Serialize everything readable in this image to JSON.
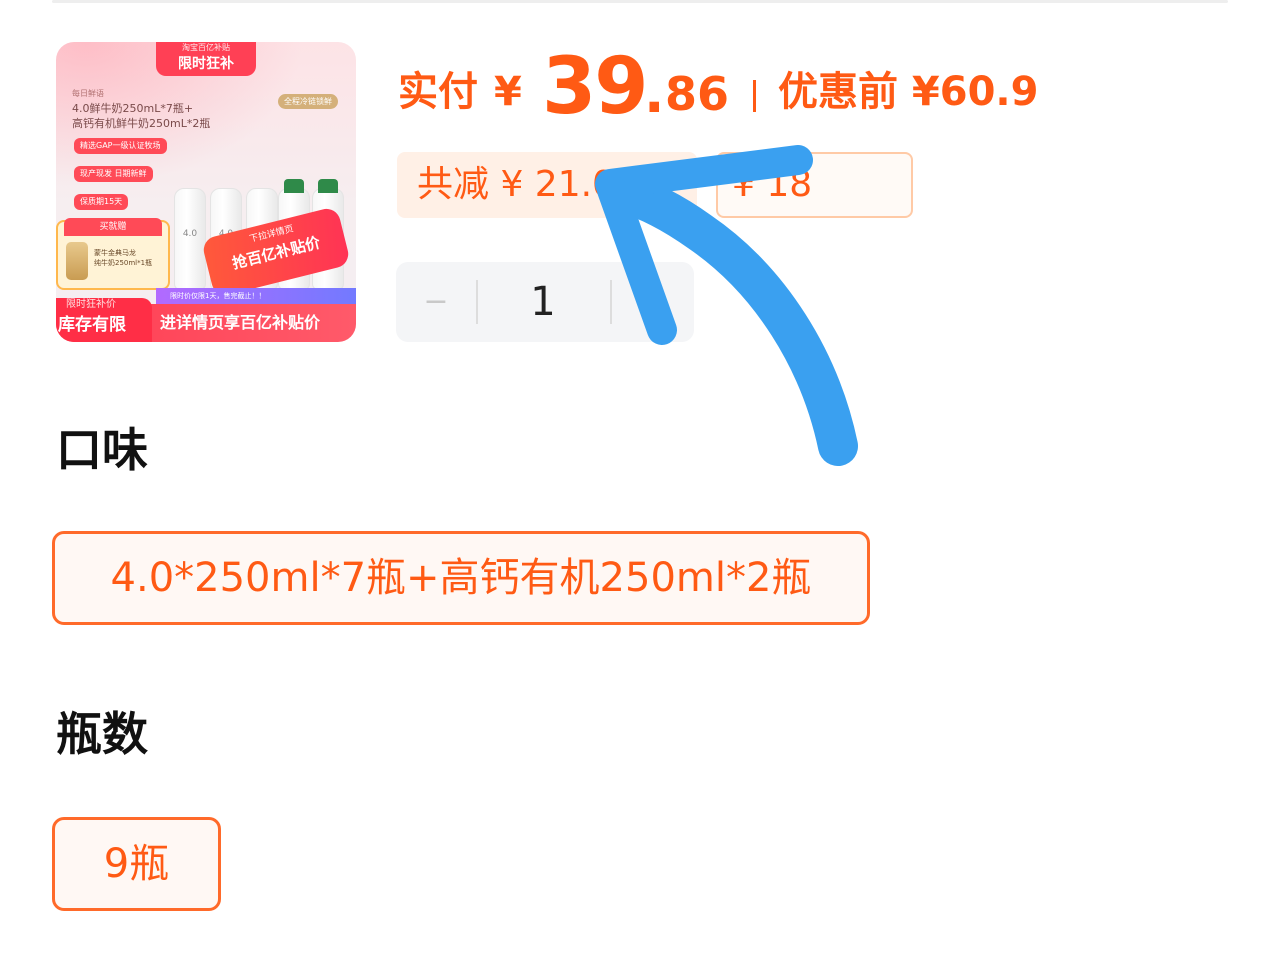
{
  "product_image": {
    "banner_sub": "淘宝百亿补贴",
    "banner_main": "限时狂补",
    "brand_line": "每日鲜语",
    "desc_line1": "4.0鲜牛奶250mL*7瓶+",
    "desc_line2": "高钙有机鲜牛奶250mL*2瓶",
    "cold_chain": "全程冷链锁鲜",
    "tags": [
      "精选GAP一级认证牧场",
      "现产现发 日期新鲜",
      "保质期15天"
    ],
    "bottle_label": "4.0",
    "gift_title": "买就赠",
    "gift_line1": "蒙牛金典马龙",
    "gift_line2": "纯牛奶250ml*1瓶",
    "flame_sub": "下拉详情页",
    "flame_main": "抢百亿补贴价",
    "notice": "限时价仅限1天，售完截止！！",
    "bar_left_small": "限时狂补价",
    "bar_left_big": "库存有限",
    "bar_right": "进详情页享百亿补贴价"
  },
  "price": {
    "paid_label": "实付",
    "currency": "¥",
    "paid_int": "39",
    "paid_dot": ".",
    "paid_dec": "86",
    "before_label": "优惠前 ¥60.9",
    "accent_color": "#ff5a14"
  },
  "badges": {
    "total_discount": "共减 ¥ 21.0",
    "coupon": "¥ 18"
  },
  "stepper": {
    "minus": "−",
    "quantity": "1",
    "plus": "+"
  },
  "sections": {
    "flavor_title": "口味",
    "flavor_option": "4.0*250ml*7瓶+高钙有机250ml*2瓶",
    "count_title": "瓶数",
    "count_option": "9瓶"
  },
  "annotation": {
    "arrow_color": "#3aa0f0"
  }
}
